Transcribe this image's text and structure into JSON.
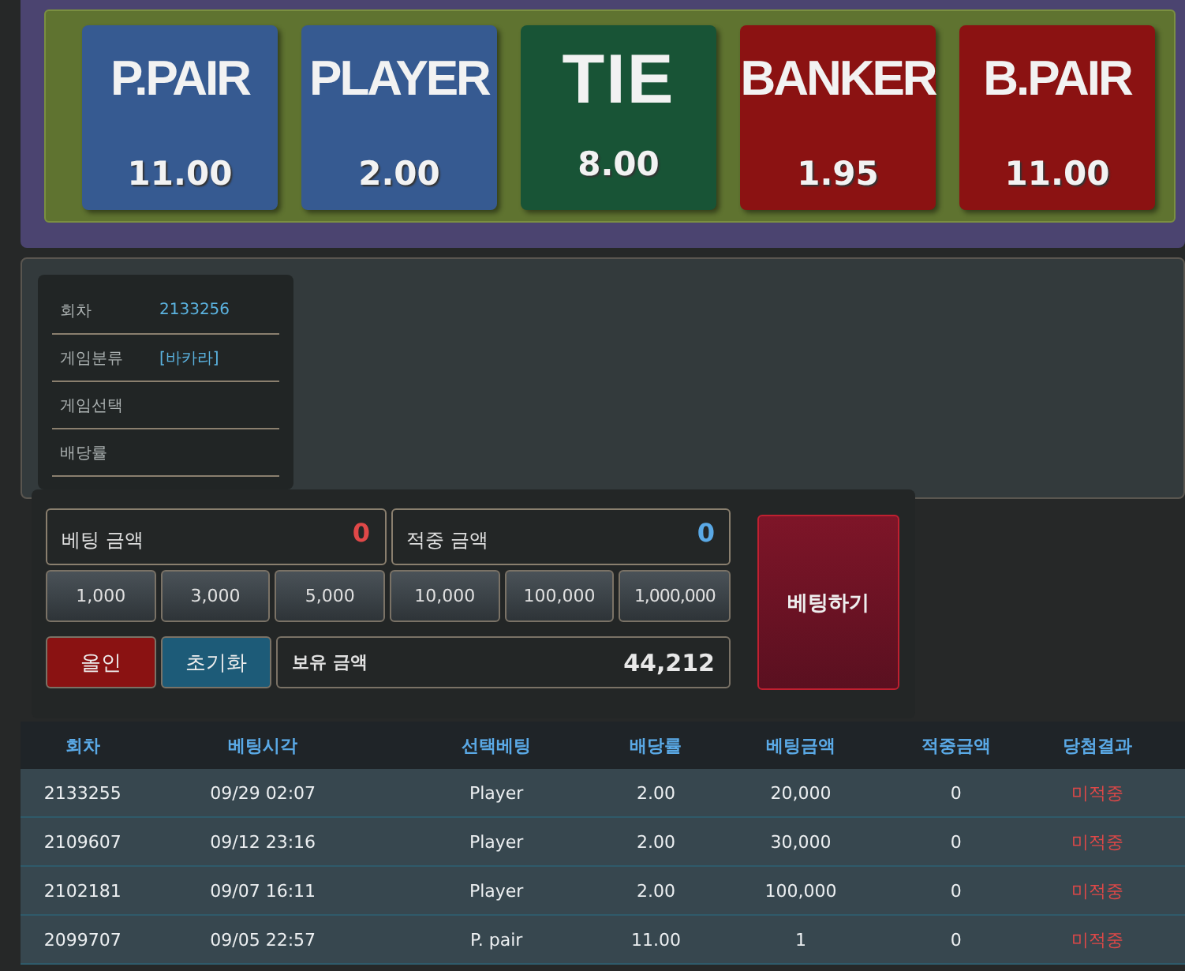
{
  "bet_options": [
    {
      "label": "P.PAIR",
      "odds": "11.00",
      "color": "#365a91"
    },
    {
      "label": "PLAYER",
      "odds": "2.00",
      "color": "#365a91"
    },
    {
      "label": "TIE",
      "odds": "8.00",
      "color": "#185436"
    },
    {
      "label": "BANKER",
      "odds": "1.95",
      "color": "#8b1212"
    },
    {
      "label": "B.PAIR",
      "odds": "11.00",
      "color": "#8b1212"
    }
  ],
  "round_info": [
    {
      "label": "회차",
      "value": "2133256"
    },
    {
      "label": "게임분류",
      "value": "[바카라]"
    },
    {
      "label": "게임선택"
    },
    {
      "label": "배당률"
    }
  ],
  "bet_amount": {
    "label": "베팅 금액",
    "value": "0"
  },
  "win_amount": {
    "label": "적중 금액",
    "value": "0"
  },
  "chips": [
    "1,000",
    "3,000",
    "5,000",
    "10,000",
    "100,000",
    "1,000,000"
  ],
  "all_in_button": "올인",
  "reset_button": "초기화",
  "balance": {
    "label": "보유 금액",
    "value": "44,212"
  },
  "bet_button": "베팅하기",
  "history": {
    "columns": [
      "회차",
      "베팅시각",
      "선택베팅",
      "배당률",
      "베팅금액",
      "적중금액",
      "당첨결과"
    ],
    "rows": [
      [
        "2133255",
        "09/29 02:07",
        "Player",
        "2.00",
        "20,000",
        "0",
        "미적중"
      ],
      [
        "2109607",
        "09/12 23:16",
        "Player",
        "2.00",
        "30,000",
        "0",
        "미적중"
      ],
      [
        "2102181",
        "09/07 16:11",
        "Player",
        "2.00",
        "100,000",
        "0",
        "미적중"
      ],
      [
        "2099707",
        "09/05 22:57",
        "P. pair",
        "11.00",
        "1",
        "0",
        "미적중"
      ]
    ]
  }
}
